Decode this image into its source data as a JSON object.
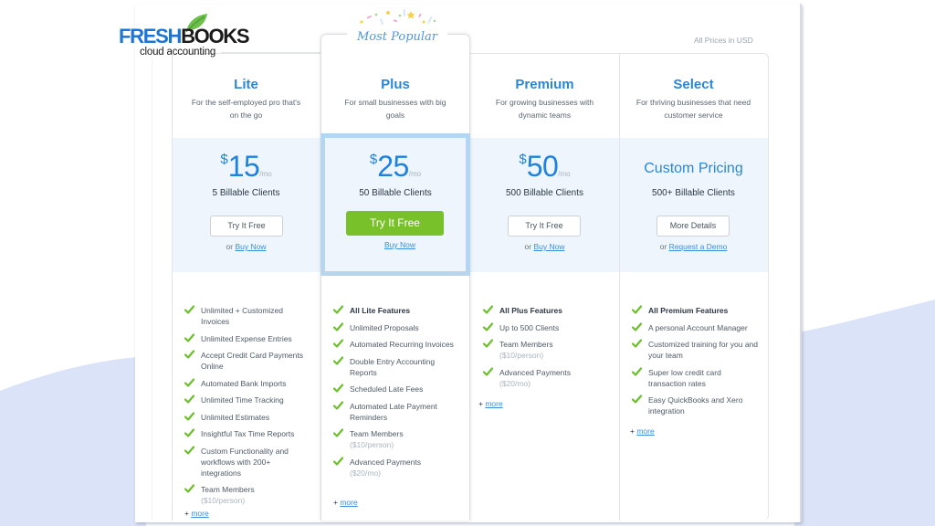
{
  "brand": {
    "name_part1": "FRESH",
    "name_part2": "BOOKS",
    "tagline": "cloud accounting"
  },
  "prices_note": "All Prices in USD",
  "most_popular_label": "Most Popular",
  "colors": {
    "accent_blue": "#2a86d9",
    "cta_green": "#78c12a",
    "highlight_border": "#b5d6f1",
    "price_band": "#eef5fc",
    "check_green": "#6bbf2a",
    "background_wave": "#dbe3f8"
  },
  "plans": [
    {
      "name": "Lite",
      "description": "For the self-employed pro that's on the go",
      "price_currency": "$",
      "price_amount": "15",
      "price_period": "/mo",
      "clients": "5 Billable Clients",
      "button_label": "Try It Free",
      "alt_prefix": "or",
      "alt_link": "Buy Now",
      "features": [
        {
          "text": "Unlimited + Customized Invoices"
        },
        {
          "text": "Unlimited Expense Entries"
        },
        {
          "text": "Accept Credit Card Payments Online"
        },
        {
          "text": "Automated Bank Imports"
        },
        {
          "text": "Unlimited Time Tracking"
        },
        {
          "text": "Unlimited Estimates"
        },
        {
          "text": "Insightful Tax Time Reports"
        },
        {
          "text": "Custom Functionality and workflows with 200+ integrations"
        },
        {
          "text": "Team Members",
          "sub": "($10/person)"
        }
      ],
      "more_prefix": "+",
      "more_label": "more"
    },
    {
      "name": "Plus",
      "description": "For small businesses with big goals",
      "price_currency": "$",
      "price_amount": "25",
      "price_period": "/mo",
      "clients": "50 Billable Clients",
      "button_label": "Try It Free",
      "alt_prefix": "or",
      "alt_link": "Buy Now",
      "features": [
        {
          "text": "All Lite Features",
          "bold": true
        },
        {
          "text": "Unlimited Proposals"
        },
        {
          "text": "Automated Recurring Invoices"
        },
        {
          "text": "Double Entry Accounting Reports"
        },
        {
          "text": "Scheduled Late Fees"
        },
        {
          "text": "Automated Late Payment Reminders"
        },
        {
          "text": "Team Members",
          "sub": "($10/person)"
        },
        {
          "text": "Advanced Payments",
          "sub": "($20/mo)"
        }
      ],
      "more_prefix": "+",
      "more_label": "more"
    },
    {
      "name": "Premium",
      "description": "For growing businesses with dynamic teams",
      "price_currency": "$",
      "price_amount": "50",
      "price_period": "/mo",
      "clients": "500 Billable Clients",
      "button_label": "Try It Free",
      "alt_prefix": "or",
      "alt_link": "Buy Now",
      "features": [
        {
          "text": "All Plus Features",
          "bold": true
        },
        {
          "text": "Up to 500 Clients"
        },
        {
          "text": "Team Members",
          "sub": "($10/person)"
        },
        {
          "text": "Advanced Payments",
          "sub": "($20/mo)"
        }
      ],
      "more_prefix": "+",
      "more_label": "more"
    },
    {
      "name": "Select",
      "description": "For thriving businesses that need customer service",
      "custom_price": "Custom Pricing",
      "clients": "500+ Billable Clients",
      "button_label": "More Details",
      "alt_prefix": "or",
      "alt_link": "Request a Demo",
      "features": [
        {
          "text": "All Premium Features",
          "bold": true
        },
        {
          "text": "A personal Account Manager"
        },
        {
          "text": "Customized training for you and your team"
        },
        {
          "text": "Super low credit card transaction rates"
        },
        {
          "text": "Easy QuickBooks and Xero integration"
        }
      ],
      "more_prefix": "+",
      "more_label": "more"
    }
  ]
}
